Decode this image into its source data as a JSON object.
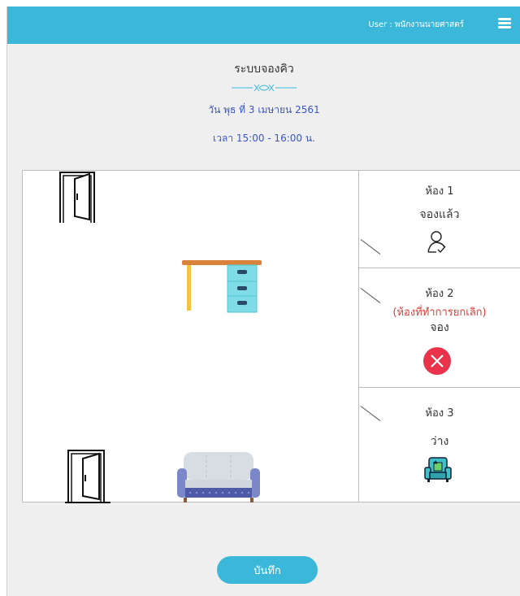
{
  "header": {
    "user_label": "User : พนักงานนายศาสตร์"
  },
  "booking": {
    "title": "ระบบจองคิว",
    "date": "วัน พุธ ที่ 3 เมษายน 2561",
    "time": "เวลา 15:00 - 16:00 น."
  },
  "rooms": [
    {
      "name": "ห้อง 1",
      "status": "จองแล้ว",
      "note": "",
      "icon": "person-check-icon"
    },
    {
      "name": "ห้อง 2",
      "status": "จอง",
      "note": "(ห้องที่ทำการยกเลิก)",
      "icon": "cancel-x-icon"
    },
    {
      "name": "ห้อง 3",
      "status": "ว่าง",
      "note": "",
      "icon": "armchair-icon"
    }
  ],
  "actions": {
    "save_label": "บันทึก"
  },
  "colors": {
    "accent": "#3bb8d9",
    "cancel": "#e8334a",
    "warning_text": "#e53935",
    "info_text": "#3b57c4"
  }
}
